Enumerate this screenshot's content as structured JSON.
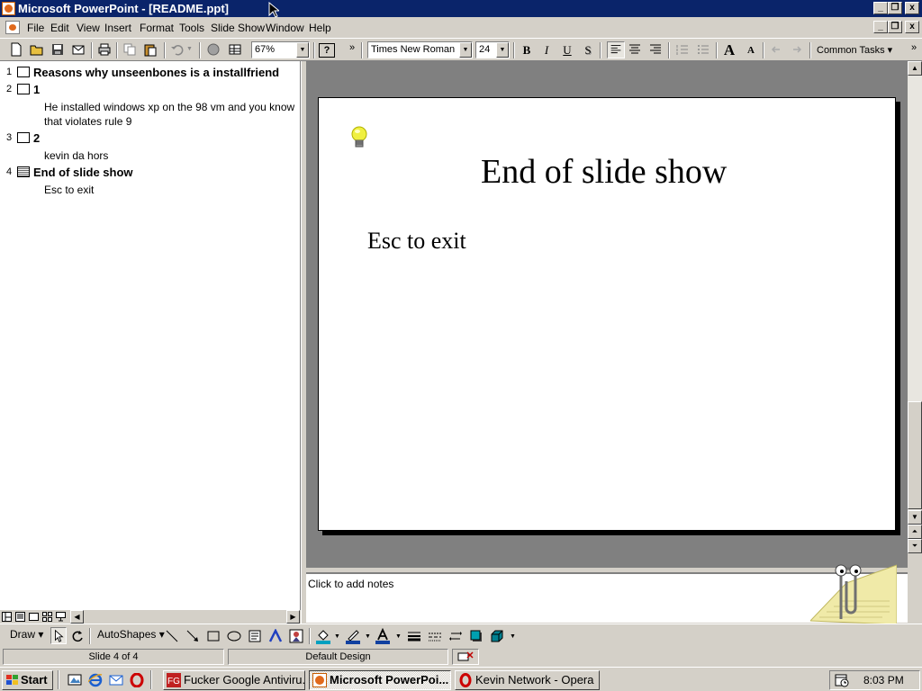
{
  "window": {
    "title": "Microsoft PowerPoint - [README.ppt]",
    "min_label": "_",
    "max_label": "❐",
    "close_label": "x"
  },
  "menu": [
    "File",
    "Edit",
    "View",
    "Insert",
    "Format",
    "Tools",
    "Slide Show",
    "Window",
    "Help"
  ],
  "toolbar": {
    "zoom": "67%",
    "font": "Times New Roman",
    "size": "24",
    "bold": "B",
    "italic": "I",
    "underline": "U",
    "shadow": "S",
    "grow_font": "A",
    "shrink_font": "A",
    "common_tasks": "Common Tasks ▾",
    "help": "?"
  },
  "outline": {
    "slides": [
      {
        "num": "1",
        "title": "Reasons why unseenbones is a installfriend",
        "body": ""
      },
      {
        "num": "2",
        "title": "1",
        "body": "He installed windows xp on the 98 vm and you know that violates rule 9"
      },
      {
        "num": "3",
        "title": "2",
        "body": "kevin da hors"
      },
      {
        "num": "4",
        "title": "End of slide show",
        "body": "Esc to exit"
      }
    ]
  },
  "slide": {
    "title": "End of slide show",
    "body": "Esc to exit"
  },
  "notes": {
    "placeholder": "Click to add notes"
  },
  "drawing": {
    "draw": "Draw ▾",
    "autoshapes": "AutoShapes ▾"
  },
  "status": {
    "slide": "Slide 4 of 4",
    "design": "Default Design"
  },
  "taskbar": {
    "start": "Start",
    "tasks": [
      {
        "label": "Fucker Google Antiviru..."
      },
      {
        "label": "Microsoft PowerPoi..."
      },
      {
        "label": "Kevin Network - Opera"
      }
    ],
    "clock": "8:03 PM"
  },
  "colors": {
    "titlebar": "#0a246a",
    "chrome": "#d4d0c8",
    "ppt_orange": "#e0691c",
    "opera_red": "#cc0000"
  }
}
